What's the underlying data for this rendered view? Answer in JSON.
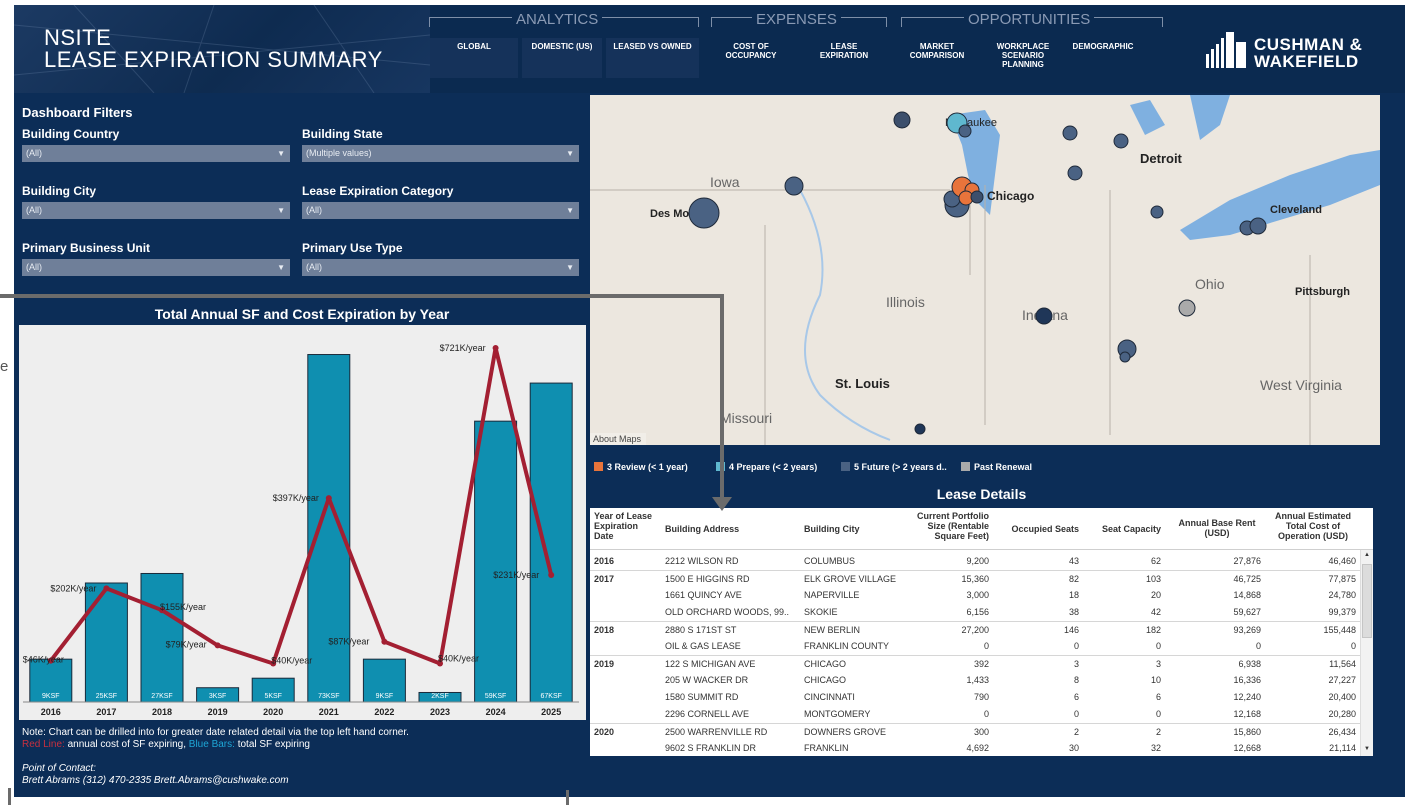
{
  "header": {
    "title_line1": "NSITE",
    "title_line2": "LEASE EXPIRATION SUMMARY",
    "groups": {
      "analytics": "ANALYTICS",
      "expenses": "EXPENSES",
      "opportunities": "OPPORTUNITIES"
    },
    "nav": {
      "global": "GLOBAL",
      "domestic": "DOMESTIC (US)",
      "leased_owned": "LEASED VS OWNED",
      "cost_occupancy": "COST OF OCCUPANCY",
      "lease_expiration": "LEASE EXPIRATION",
      "market_comparison": "MARKET COMPARISON",
      "workplace_planning": "WORKPLACE SCENARIO PLANNING",
      "demographic": "DEMOGRAPHIC"
    },
    "logo_line1": "CUSHMAN &",
    "logo_line2": "WAKEFIELD"
  },
  "filters": {
    "heading": "Dashboard Filters",
    "building_country": {
      "label": "Building Country",
      "value": "(All)"
    },
    "building_state": {
      "label": "Building State",
      "value": "(Multiple values)"
    },
    "building_city": {
      "label": "Building City",
      "value": "(All)"
    },
    "lease_category": {
      "label": "Lease Expiration Category",
      "value": "(All)"
    },
    "business_unit": {
      "label": "Primary Business Unit",
      "value": "(All)"
    },
    "use_type": {
      "label": "Primary Use Type",
      "value": "(All)"
    }
  },
  "chart_data": {
    "type": "bar",
    "title": "Total Annual SF and Cost Expiration by Year",
    "categories": [
      "2016",
      "2017",
      "2018",
      "2019",
      "2020",
      "2021",
      "2022",
      "2023",
      "2024",
      "2025"
    ],
    "series": [
      {
        "name": "total SF expiring",
        "values": [
          9,
          25,
          27,
          3,
          5,
          73,
          9,
          2,
          59,
          67
        ],
        "labels": [
          "9KSF",
          "25KSF",
          "27KSF",
          "3KSF",
          "5KSF",
          "73KSF",
          "9KSF",
          "2KSF",
          "59KSF",
          "67KSF"
        ],
        "color": "#0f8fb0"
      },
      {
        "name": "annual cost of SF expiring",
        "values": [
          46,
          202,
          155,
          79,
          40,
          397,
          87,
          40,
          721,
          231
        ],
        "labels": [
          "$46K/year",
          "$202K/year",
          "$155K/year",
          "$79K/year",
          "$40K/year",
          "$397K/year",
          "$87K/year",
          "$40K/year",
          "$721K/year",
          "$231K/year"
        ],
        "color": "#a31f32"
      }
    ]
  },
  "chart_notes": {
    "note": "Note: Chart can be drilled into for greater date related detail via the top left hand corner.",
    "red_label": "Red Line:",
    "red_text": " annual cost of SF expiring, ",
    "blue_label": "Blue Bars:",
    "blue_text": " total SF expiring",
    "contact_label": "Point of Contact:",
    "contact": "Brett Abrams (312) 470-2335 Brett.Abrams@cushwake.com"
  },
  "map": {
    "attribution": "About Maps",
    "places": [
      "Milwaukee",
      "Detroit",
      "Iowa",
      "Chicago",
      "Des Moines",
      "Cleveland",
      "Ohio",
      "Illinois",
      "Pittsburgh",
      "Indiana",
      "St. Louis",
      "West Virginia",
      "Missouri"
    ],
    "legend": [
      {
        "label": "3 Review (< 1 year)",
        "color": "#e8743b"
      },
      {
        "label": "4 Prepare (< 2 years)",
        "color": "#5fb8cf"
      },
      {
        "label": "5 Future (> 2 years d..",
        "color": "#4a6283"
      },
      {
        "label": "Past Renewal",
        "color": "#aaaaaa"
      }
    ]
  },
  "table": {
    "title": "Lease Details",
    "columns": [
      "Year of Lease Expiration Date",
      "Building Address",
      "Building City",
      "Current Portfolio Size (Rentable Square Feet)",
      "Occupied Seats",
      "Seat Capacity",
      "Annual Base Rent (USD)",
      "Annual Estimated Total Cost of Operation (USD)"
    ],
    "rows": [
      [
        "2016",
        "2212 WILSON RD",
        "COLUMBUS",
        "9,200",
        "43",
        "62",
        "27,876",
        "46,460"
      ],
      [
        "2017",
        "1500 E HIGGINS RD",
        "ELK GROVE VILLAGE",
        "15,360",
        "82",
        "103",
        "46,725",
        "77,875"
      ],
      [
        "",
        "1661 QUINCY AVE",
        "NAPERVILLE",
        "3,000",
        "18",
        "20",
        "14,868",
        "24,780"
      ],
      [
        "",
        "OLD ORCHARD WOODS, 99..",
        "SKOKIE",
        "6,156",
        "38",
        "42",
        "59,627",
        "99,379"
      ],
      [
        "2018",
        "2880 S 171ST ST",
        "NEW BERLIN",
        "27,200",
        "146",
        "182",
        "93,269",
        "155,448"
      ],
      [
        "",
        "OIL & GAS LEASE",
        "FRANKLIN COUNTY",
        "0",
        "0",
        "0",
        "0",
        "0"
      ],
      [
        "2019",
        "122 S MICHIGAN AVE",
        "CHICAGO",
        "392",
        "3",
        "3",
        "6,938",
        "11,564"
      ],
      [
        "",
        "205 W WACKER DR",
        "CHICAGO",
        "1,433",
        "8",
        "10",
        "16,336",
        "27,227"
      ],
      [
        "",
        "1580 SUMMIT RD",
        "CINCINNATI",
        "790",
        "6",
        "6",
        "12,240",
        "20,400"
      ],
      [
        "",
        "2296 CORNELL AVE",
        "MONTGOMERY",
        "0",
        "0",
        "0",
        "12,168",
        "20,280"
      ],
      [
        "2020",
        "2500 WARRENVILLE RD",
        "DOWNERS GROVE",
        "300",
        "2",
        "2",
        "15,860",
        "26,434"
      ],
      [
        "",
        "9602 S FRANKLIN DR",
        "FRANKLIN",
        "4,692",
        "30",
        "32",
        "12,668",
        "21,114"
      ]
    ]
  },
  "colors": {
    "background": "#0c2d57",
    "bar": "#0f8fb0",
    "line": "#a31f32",
    "overlay": "#6b6b6b"
  }
}
